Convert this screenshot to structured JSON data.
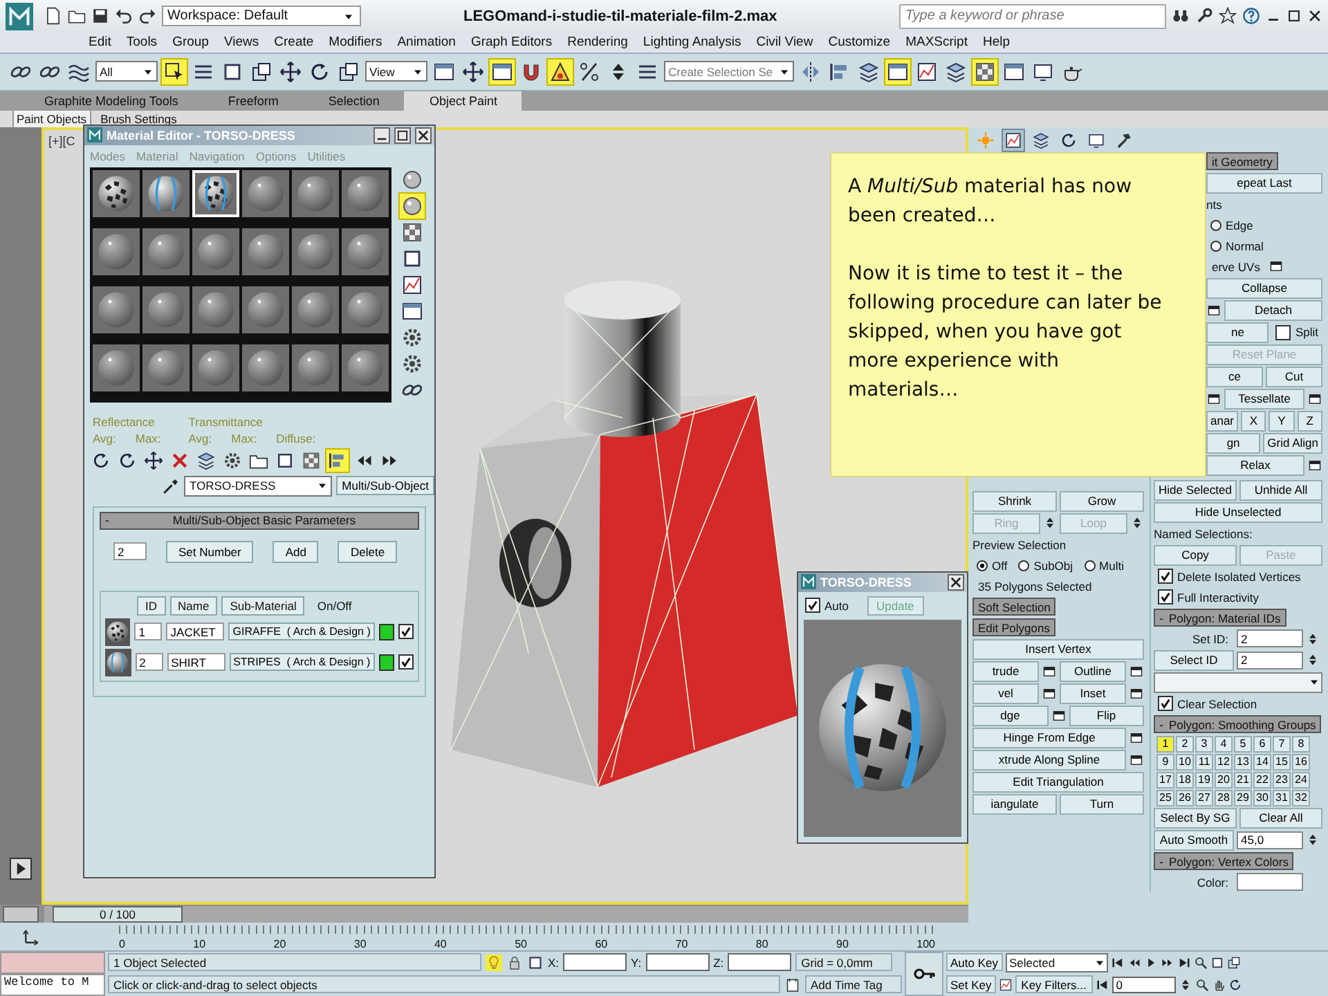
{
  "title_bar": {
    "workspace": "Workspace: Default",
    "file_title": "LEGOmand-i-studie-til-materiale-film-2.max",
    "search": {
      "placeholder": "Type a keyword or phrase"
    }
  },
  "menu": [
    "Edit",
    "Tools",
    "Group",
    "Views",
    "Create",
    "Modifiers",
    "Animation",
    "Graph Editors",
    "Rendering",
    "Lighting Analysis",
    "Civil View",
    "Customize",
    "MAXScript",
    "Help"
  ],
  "toolbar": {
    "tools": [
      {
        "kind": "link",
        "active": false
      },
      {
        "kind": "unlink",
        "active": false
      },
      {
        "kind": "bind",
        "active": false
      },
      {
        "kind": "dropdown",
        "value": "All"
      },
      {
        "kind": "select",
        "active": true
      },
      {
        "kind": "select_by_name",
        "active": false
      },
      {
        "kind": "region",
        "active": false
      },
      {
        "kind": "crossing",
        "active": false
      },
      {
        "kind": "move",
        "active": false
      },
      {
        "kind": "rotate",
        "active": false
      },
      {
        "kind": "scale",
        "active": false
      },
      {
        "kind": "dropdown",
        "value": "View"
      },
      {
        "kind": "pivot",
        "active": false
      },
      {
        "kind": "manipulate",
        "active": false
      },
      {
        "kind": "shortcut",
        "active": true
      },
      {
        "kind": "snap",
        "active": false
      },
      {
        "kind": "angle_snap",
        "active": true
      },
      {
        "kind": "percent_snap",
        "active": false
      },
      {
        "kind": "spinner_snap",
        "active": false
      },
      {
        "kind": "named_sets",
        "active": false
      },
      {
        "kind": "dropdown",
        "placeholder": "Create Selection Se"
      },
      {
        "kind": "mirror",
        "active": false
      },
      {
        "kind": "align",
        "active": false
      },
      {
        "kind": "layers",
        "active": false
      },
      {
        "kind": "ribbon",
        "active": true
      },
      {
        "kind": "curve_editor",
        "active": false
      },
      {
        "kind": "schematic",
        "active": false
      },
      {
        "kind": "material_editor",
        "active": true
      },
      {
        "kind": "render_setup",
        "active": false
      },
      {
        "kind": "render_frame",
        "active": false
      },
      {
        "kind": "render",
        "active": false
      }
    ]
  },
  "ribbon": {
    "tabs": [
      {
        "label": "Graphite Modeling Tools",
        "selected": false
      },
      {
        "label": "Freeform",
        "selected": false
      },
      {
        "label": "Selection",
        "selected": false
      },
      {
        "label": "Object Paint",
        "selected": true
      }
    ],
    "panels": [
      {
        "label": "Paint Objects",
        "selected": true
      },
      {
        "label": "Brush Settings",
        "selected": false
      }
    ]
  },
  "viewport": {
    "label": "[+][C"
  },
  "material_editor": {
    "title": "Material Editor - TORSO-DRESS",
    "menu": [
      "Modes",
      "Material",
      "Navigation",
      "Options",
      "Utilities"
    ],
    "slots": [
      {
        "kind": "giraffe",
        "selected": false
      },
      {
        "kind": "stripes",
        "selected": false
      },
      {
        "kind": "mixed",
        "selected": true
      },
      {
        "kind": "plain",
        "selected": false
      },
      {
        "kind": "plain",
        "selected": false
      },
      {
        "kind": "plain",
        "selected": false
      },
      {
        "kind": "plain",
        "selected": false
      },
      {
        "kind": "plain",
        "selected": false
      },
      {
        "kind": "plain",
        "selected": false
      },
      {
        "kind": "plain",
        "selected": false
      },
      {
        "kind": "plain",
        "selected": false
      },
      {
        "kind": "plain",
        "selected": false
      },
      {
        "kind": "plain",
        "selected": false
      },
      {
        "kind": "plain",
        "selected": false
      },
      {
        "kind": "plain",
        "selected": false
      },
      {
        "kind": "plain",
        "selected": false
      },
      {
        "kind": "plain",
        "selected": false
      },
      {
        "kind": "plain",
        "selected": false
      },
      {
        "kind": "plain",
        "selected": false
      },
      {
        "kind": "plain",
        "selected": false
      },
      {
        "kind": "plain",
        "selected": false
      },
      {
        "kind": "plain",
        "selected": false
      },
      {
        "kind": "plain",
        "selected": false
      },
      {
        "kind": "plain",
        "selected": false
      }
    ],
    "side_tools": [
      {
        "kind": "sample_type",
        "active": false
      },
      {
        "kind": "backlight",
        "active": true
      },
      {
        "kind": "background",
        "active": false
      },
      {
        "kind": "tiling",
        "active": false
      },
      {
        "kind": "video_check",
        "active": false
      },
      {
        "kind": "preview",
        "active": false
      },
      {
        "kind": "options",
        "active": false
      },
      {
        "kind": "select_by_material",
        "active": false
      },
      {
        "kind": "navigator",
        "active": false
      }
    ],
    "reflectance": {
      "label": "Reflectance",
      "avg": "Avg:",
      "max": "Max:"
    },
    "transmittance": {
      "label": "Transmittance",
      "avg": "Avg:",
      "max": "Max:",
      "diffuse": "Diffuse:"
    },
    "tools": [
      {
        "kind": "get",
        "active": false
      },
      {
        "kind": "put",
        "active": false
      },
      {
        "kind": "assign",
        "active": false
      },
      {
        "kind": "reset",
        "active": false
      },
      {
        "kind": "copy",
        "active": false
      },
      {
        "kind": "unique",
        "active": false
      },
      {
        "kind": "library",
        "active": false
      },
      {
        "kind": "channel",
        "active": false
      },
      {
        "kind": "show_map",
        "active": false
      },
      {
        "kind": "end_result",
        "active": true
      },
      {
        "kind": "parent",
        "active": false
      },
      {
        "kind": "forward",
        "active": false
      }
    ],
    "material_name": "TORSO-DRESS",
    "material_type": "Multi/Sub-Object",
    "rollout": {
      "sign": "-",
      "title": "Multi/Sub-Object Basic Parameters",
      "count": "2",
      "buttons": [
        "Set Number",
        "Add",
        "Delete"
      ],
      "columns": [
        "ID",
        "Name",
        "Sub-Material",
        "On/Off"
      ],
      "rows": [
        {
          "kind": "giraffe",
          "id": "1",
          "name": "JACKET",
          "sub_material": "GIRAFFE  ( Arch & Design )",
          "on": true
        },
        {
          "kind": "stripes",
          "id": "2",
          "name": "SHIRT",
          "sub_material": "STRIPES  ( Arch & Design )",
          "on": true
        }
      ]
    }
  },
  "callout": {
    "paragraphs": [
      "A *Multi/Sub* material has now been created…",
      "Now it is time to test it – the following procedure can later be skipped, when you have got more experience with materials…"
    ]
  },
  "preview_window": {
    "title": "TORSO-DRESS",
    "auto": {
      "label": "Auto",
      "checked": true
    },
    "update": "Update"
  },
  "command_panel": {
    "tabs": [
      {
        "kind": "create",
        "selected": false
      },
      {
        "kind": "modify",
        "selected": true
      },
      {
        "kind": "hierarchy",
        "selected": false
      },
      {
        "kind": "motion",
        "selected": false
      },
      {
        "kind": "display",
        "selected": false
      },
      {
        "kind": "utilities",
        "selected": false
      }
    ],
    "left": {
      "rows": [
        [
          {
            "kind": "button",
            "label": "Shrink",
            "disabled": false
          },
          {
            "kind": "button",
            "label": "Grow",
            "disabled": false
          }
        ],
        [
          {
            "kind": "button",
            "label": "Ring",
            "disabled": true
          },
          {
            "kind": "spinner"
          },
          {
            "kind": "button",
            "label": "Loop",
            "disabled": true
          },
          {
            "kind": "spinner"
          }
        ],
        [
          {
            "kind": "group",
            "label": "Preview Selection"
          }
        ],
        [
          {
            "kind": "radio",
            "label": "Off",
            "selected": true
          },
          {
            "kind": "radio",
            "label": "SubObj",
            "selected": false
          },
          {
            "kind": "radio",
            "label": "Multi",
            "selected": false
          }
        ],
        [
          {
            "kind": "label",
            "label": "35 Polygons Selected"
          }
        ],
        [
          {
            "kind": "header",
            "label": "Soft Selection"
          }
        ],
        [
          {
            "kind": "header",
            "label": "Edit Polygons"
          }
        ],
        [
          {
            "kind": "button",
            "label": "Insert Vertex",
            "disabled": false
          }
        ],
        [
          {
            "kind": "button",
            "label": "trude",
            "disabled": false
          },
          {
            "kind": "settings"
          },
          {
            "kind": "button",
            "label": "Outline",
            "disabled": false
          },
          {
            "kind": "settings"
          }
        ],
        [
          {
            "kind": "button",
            "label": "vel",
            "disabled": false
          },
          {
            "kind": "settings"
          },
          {
            "kind": "button",
            "label": "Inset",
            "disabled": false
          },
          {
            "kind": "settings"
          }
        ],
        [
          {
            "kind": "button",
            "label": "dge",
            "disabled": false
          },
          {
            "kind": "settings"
          },
          {
            "kind": "button",
            "label": "Flip",
            "disabled": false
          }
        ],
        [
          {
            "kind": "button",
            "label": "Hinge From Edge",
            "disabled": false
          },
          {
            "kind": "settings"
          }
        ],
        [
          {
            "kind": "button",
            "label": "xtrude Along Spline",
            "disabled": false
          },
          {
            "kind": "settings"
          }
        ],
        [
          {
            "kind": "button",
            "label": "Edit Triangulation",
            "disabled": false
          }
        ],
        [
          {
            "kind": "button",
            "label": "iangulate",
            "disabled": false
          },
          {
            "kind": "button",
            "label": "Turn",
            "disabled": false
          }
        ]
      ]
    },
    "right": {
      "covered_rows": [
        [
          {
            "kind": "header",
            "label": "it Geometry"
          }
        ],
        [
          {
            "kind": "button",
            "label": "epeat Last",
            "disabled": false
          }
        ],
        [
          {
            "kind": "group",
            "label": "nts"
          }
        ],
        [
          {
            "kind": "radio",
            "label": "Edge",
            "selected": false
          }
        ],
        [
          {
            "kind": "radio",
            "label": "Normal",
            "selected": false
          }
        ],
        [
          {
            "kind": "label",
            "label": "erve UVs"
          },
          {
            "kind": "settings"
          }
        ],
        [
          {
            "kind": "button",
            "label": "Collapse",
            "disabled": false
          }
        ],
        [
          {
            "kind": "settings"
          },
          {
            "kind": "button",
            "label": "Detach",
            "disabled": false
          }
        ],
        [
          {
            "kind": "button",
            "label": "ne",
            "disabled": false
          },
          {
            "kind": "check",
            "label": "Split",
            "checked": false
          }
        ],
        [
          {
            "kind": "button",
            "label": "Reset Plane",
            "disabled": true
          }
        ],
        [
          {
            "kind": "button",
            "label": "ce",
            "disabled": false
          },
          {
            "kind": "button",
            "label": "Cut",
            "disabled": false
          }
        ],
        [
          {
            "kind": "settings"
          },
          {
            "kind": "button",
            "label": "Tessellate",
            "disabled": false
          },
          {
            "kind": "settings"
          }
        ],
        [
          {
            "kind": "button",
            "label": "anar",
            "disabled": false
          },
          {
            "kind": "button",
            "label": "X",
            "disabled": false
          },
          {
            "kind": "button",
            "label": "Y",
            "disabled": false
          },
          {
            "kind": "button",
            "label": "Z",
            "disabled": false
          }
        ],
        [
          {
            "kind": "button",
            "label": "gn",
            "disabled": false
          },
          {
            "kind": "button",
            "label": "Grid Align",
            "disabled": false
          }
        ],
        [
          {
            "kind": "button",
            "label": "Relax",
            "disabled": false
          },
          {
            "kind": "settings"
          }
        ]
      ],
      "rows": [
        [
          {
            "kind": "button",
            "label": "Hide Selected",
            "disabled": false
          },
          {
            "kind": "button",
            "label": "Unhide All",
            "disabled": false
          }
        ],
        [
          {
            "kind": "button",
            "label": "Hide Unselected",
            "disabled": false
          }
        ],
        [
          {
            "kind": "group",
            "label": "Named Selections:"
          }
        ],
        [
          {
            "kind": "button",
            "label": "Copy",
            "disabled": false
          },
          {
            "kind": "button",
            "label": "Paste",
            "disabled": true
          }
        ],
        [
          {
            "kind": "check",
            "label": "Delete Isolated Vertices",
            "checked": true
          }
        ],
        [
          {
            "kind": "check",
            "label": "Full Interactivity",
            "checked": true
          }
        ],
        [
          {
            "kind": "header",
            "sign": "-",
            "label": "Polygon: Material IDs"
          }
        ],
        [
          {
            "kind": "label",
            "label": "Set ID:"
          },
          {
            "kind": "field",
            "value": "2"
          },
          {
            "kind": "spinner"
          }
        ],
        [
          {
            "kind": "button",
            "label": "Select ID",
            "disabled": false
          },
          {
            "kind": "field",
            "value": "2"
          },
          {
            "kind": "spinner"
          }
        ],
        [
          {
            "kind": "dropdown"
          }
        ],
        [
          {
            "kind": "check",
            "label": "Clear Selection",
            "checked": true
          }
        ],
        [
          {
            "kind": "header",
            "sign": "-",
            "label": "Polygon: Smoothing Groups"
          }
        ],
        [
          {
            "kind": "groups",
            "items": [
              {
                "label": "1",
                "selected": true
              },
              {
                "label": "2",
                "selected": false
              },
              {
                "label": "3",
                "selected": false
              },
              {
                "label": "4",
                "selected": false
              },
              {
                "label": "5",
                "selected": false
              },
              {
                "label": "6",
                "selected": false
              },
              {
                "label": "7",
                "selected": false
              },
              {
                "label": "8",
                "selected": false
              },
              {
                "label": "9",
                "selected": false
              },
              {
                "label": "10",
                "selected": false
              },
              {
                "label": "11",
                "selected": false
              },
              {
                "label": "12",
                "selected": false
              },
              {
                "label": "13",
                "selected": false
              },
              {
                "label": "14",
                "selected": false
              },
              {
                "label": "15",
                "selected": false
              },
              {
                "label": "16",
                "selected": false
              },
              {
                "label": "17",
                "selected": false
              },
              {
                "label": "18",
                "selected": false
              },
              {
                "label": "19",
                "selected": false
              },
              {
                "label": "20",
                "selected": false
              },
              {
                "label": "21",
                "selected": false
              },
              {
                "label": "22",
                "selected": false
              },
              {
                "label": "23",
                "selected": false
              },
              {
                "label": "24",
                "selected": false
              },
              {
                "label": "25",
                "selected": false
              },
              {
                "label": "26",
                "selected": false
              },
              {
                "label": "27",
                "selected": false
              },
              {
                "label": "28",
                "selected": false
              },
              {
                "label": "29",
                "selected": false
              },
              {
                "label": "30",
                "selected": false
              },
              {
                "label": "31",
                "selected": false
              },
              {
                "label": "32",
                "selected": false
              }
            ]
          }
        ],
        [
          {
            "kind": "button",
            "label": "Select By SG",
            "disabled": false
          },
          {
            "kind": "button",
            "label": "Clear All",
            "disabled": false
          }
        ],
        [
          {
            "kind": "button",
            "label": "Auto Smooth",
            "disabled": false
          },
          {
            "kind": "field",
            "value": "45,0"
          },
          {
            "kind": "spinner"
          }
        ],
        [
          {
            "kind": "header",
            "sign": "-",
            "label": "Polygon: Vertex Colors"
          }
        ],
        [
          {
            "kind": "label",
            "label": "Color:"
          },
          {
            "kind": "field"
          }
        ]
      ]
    }
  },
  "timeline": {
    "position": "0 / 100",
    "ticks": [
      "0",
      "10",
      "20",
      "30",
      "40",
      "50",
      "60",
      "70",
      "80",
      "90",
      "100"
    ]
  },
  "status_bar": {
    "listener": "Welcome to M",
    "selection": "1 Object Selected",
    "x_label": "X:",
    "y_label": "Y:",
    "z_label": "Z:",
    "grid": "Grid = 0,0mm",
    "prompt": "Click or click-and-drag to select objects",
    "time_tag": "Add Time Tag"
  },
  "animation_controls": {
    "auto_key": "Auto Key",
    "key_mode": "Selected",
    "set_key": "Set Key",
    "key_filters": "Key Filters...",
    "frame": "0"
  }
}
